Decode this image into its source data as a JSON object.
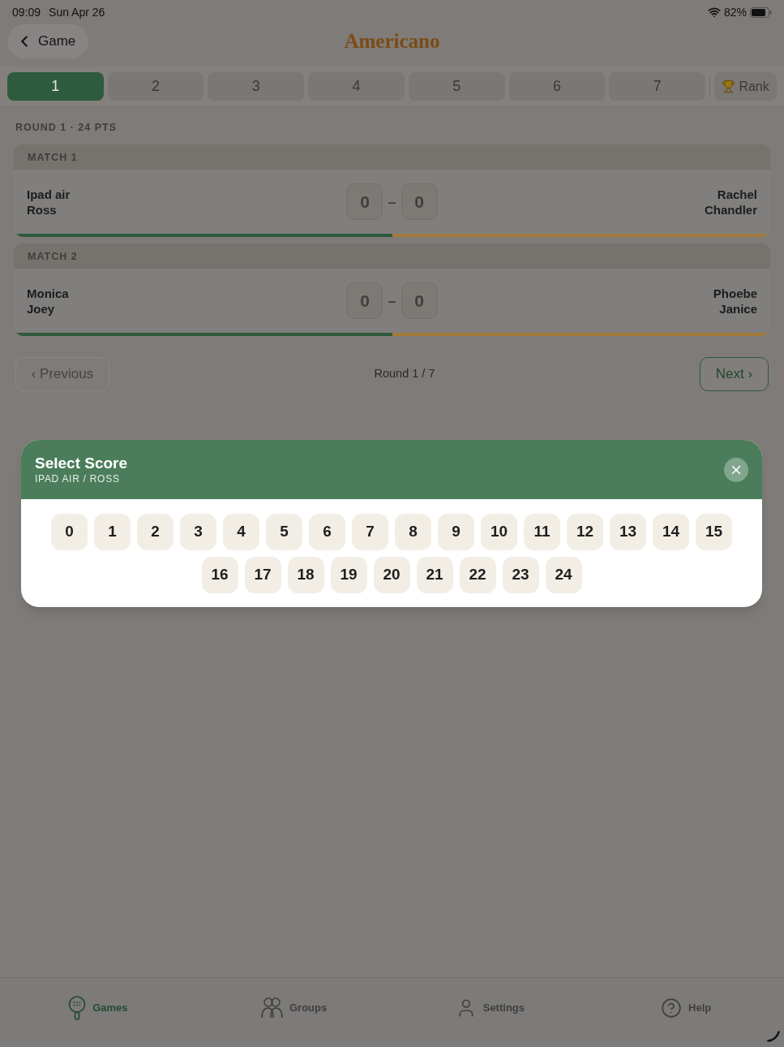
{
  "status_bar": {
    "time": "09:09",
    "date": "Sun Apr 26",
    "battery": "82%"
  },
  "nav": {
    "back": "Game",
    "title": "Americano"
  },
  "tabs": [
    {
      "kind": "round",
      "label": "1",
      "selected": true
    },
    {
      "kind": "round",
      "label": "2",
      "selected": false
    },
    {
      "kind": "round",
      "label": "3",
      "selected": false
    },
    {
      "kind": "round",
      "label": "4",
      "selected": false
    },
    {
      "kind": "round",
      "label": "5",
      "selected": false
    },
    {
      "kind": "round",
      "label": "6",
      "selected": false
    },
    {
      "kind": "round",
      "label": "7",
      "selected": false
    },
    {
      "kind": "rank",
      "label": "Rank",
      "selected": false
    }
  ],
  "round_header": "ROUND 1 · 24 PTS",
  "matches": [
    {
      "title": "MATCH 1",
      "team_1": [
        "Ipad air",
        "Ross"
      ],
      "score_1": "0",
      "score_separator": "–",
      "score_2": "0",
      "team_2": [
        "Rachel",
        "Chandler"
      ],
      "level": 0.5
    },
    {
      "title": "MATCH 2",
      "team_1": [
        "Monica",
        "Joey"
      ],
      "score_1": "0",
      "score_separator": "–",
      "score_2": "0",
      "team_2": [
        "Phoebe",
        "Janice"
      ],
      "level": 0.5
    }
  ],
  "pager": {
    "previous": {
      "label": "‹ Previous",
      "disabled": true
    },
    "position": "Round 1 / 7",
    "next": {
      "label": "Next ›",
      "disabled": false
    }
  },
  "score_dialog": {
    "title": "Select Score",
    "subtitle": "IPAD AIR / ROSS",
    "options": [
      "0",
      "1",
      "2",
      "3",
      "4",
      "5",
      "6",
      "7",
      "8",
      "9",
      "10",
      "11",
      "12",
      "13",
      "14",
      "15",
      "16",
      "17",
      "18",
      "19",
      "20",
      "21",
      "22",
      "23",
      "24"
    ]
  },
  "tab_bar": [
    {
      "kind": "games",
      "label": "Games",
      "selected": true
    },
    {
      "kind": "groups",
      "label": "Groups",
      "selected": false
    },
    {
      "kind": "settings",
      "label": "Settings",
      "selected": false
    },
    {
      "kind": "help",
      "label": "Help",
      "selected": false
    }
  ]
}
